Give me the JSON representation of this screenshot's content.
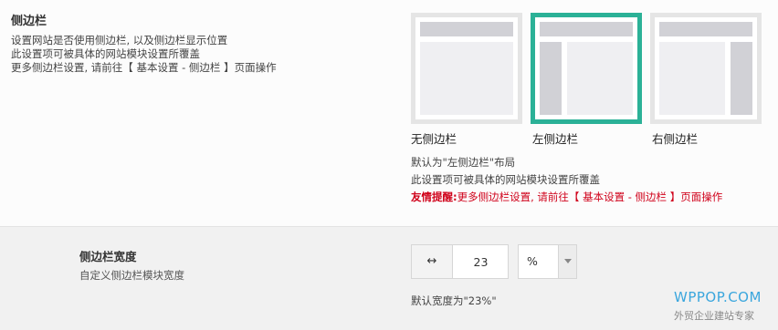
{
  "sidebar_section": {
    "title": "侧边栏",
    "desc": [
      "设置网站是否使用侧边栏, 以及侧边栏显示位置",
      "此设置项可被具体的网站模块设置所覆盖",
      "更多侧边栏设置, 请前往【 基本设置 - 侧边栏 】页面操作"
    ],
    "options": [
      {
        "label": "无侧边栏",
        "selected": false
      },
      {
        "label": "左侧边栏",
        "selected": true
      },
      {
        "label": "右侧边栏",
        "selected": false
      }
    ],
    "notes": {
      "default": "默认为\"左侧边栏\"布局",
      "override": "此设置项可被具体的网站模块设置所覆盖",
      "tip_prefix": "友情提醒:",
      "tip_text": "更多侧边栏设置, 请前往【 基本设置 - 侧边栏 】页面操作"
    },
    "colors": {
      "selected_border": "#2bb197",
      "warning": "#d0021b"
    }
  },
  "width_section": {
    "title": "侧边栏宽度",
    "desc": "自定义侧边栏模块宽度",
    "addon": "↔",
    "addon_icon": "horizontal-arrows-icon",
    "value": "23",
    "unit": "%",
    "default_note": "默认宽度为\"23%\""
  },
  "watermark": {
    "main": "WPPOP.COM",
    "sub": "外贸企业建站专家"
  }
}
